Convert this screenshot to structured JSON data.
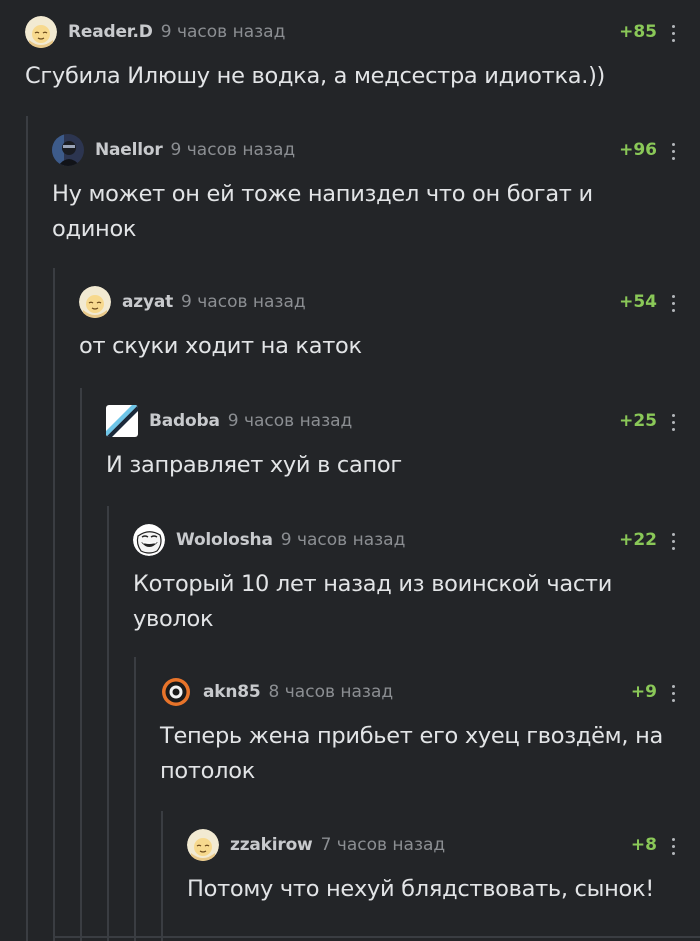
{
  "comments": [
    {
      "username": "Reader.D",
      "time": "9 часов назад",
      "rating": "+85",
      "text": "Сгубила Илюшу не водка, а медсестра идиотка.))",
      "avatar": "sleepy-face-avatar"
    },
    {
      "username": "Naellor",
      "time": "9 часов назад",
      "rating": "+96",
      "text": "Ну может он ей тоже напиздел что он богат и одинок",
      "avatar": "photo-avatar"
    },
    {
      "username": "azyat",
      "time": "9 часов назад",
      "rating": "+54",
      "text": "от скуки ходит на каток",
      "avatar": "sleepy-face-avatar"
    },
    {
      "username": "Badoba",
      "time": "9 часов назад",
      "rating": "+25",
      "text": "И заправляет хуй в сапог",
      "avatar": "diagonal-avatar"
    },
    {
      "username": "Wololosha",
      "time": "9 часов назад",
      "rating": "+22",
      "text": "Который 10 лет назад из воинской части уволок",
      "avatar": "troll-face-avatar"
    },
    {
      "username": "akn85",
      "time": "8 часов назад",
      "rating": "+9",
      "text": "Теперь жена прибьет его хуец гвоздём, на потолок",
      "avatar": "ring-avatar"
    },
    {
      "username": "zzakirow",
      "time": "7 часов назад",
      "rating": "+8",
      "text": "Потому что нехуй блядствовать, сынок!",
      "avatar": "sleepy-face-avatar"
    }
  ],
  "colors": {
    "background": "#232528",
    "text": "#e2e4e6",
    "username": "#c8cacd",
    "time": "#8b8e92",
    "rating": "#8ac858",
    "thread_line": "#3a3d42"
  }
}
